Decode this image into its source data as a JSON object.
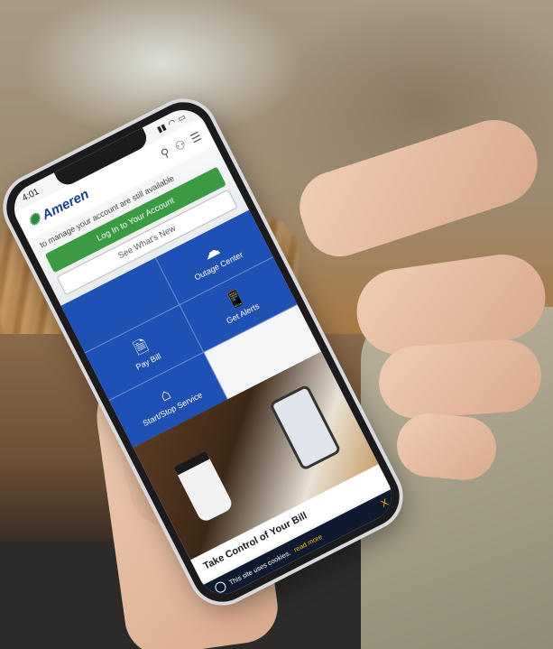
{
  "status": {
    "time": "4:01"
  },
  "app": {
    "brand": "Ameren"
  },
  "hero": {
    "text": "to manage your account are still available",
    "login_label": "Log In to Your Account",
    "whats_new_label": "See What's New"
  },
  "tiles": [
    {
      "label": "Outage Center",
      "icon": "cloud-icon"
    },
    {
      "label": "Pay Bill",
      "icon": "bill-icon"
    },
    {
      "label": "Get Alerts",
      "icon": "phone-alert-icon"
    },
    {
      "label": "Start/Stop Service",
      "icon": "house-icon"
    }
  ],
  "promo": {
    "title": "Take Control of Your Bill"
  },
  "cookie": {
    "text": "This site uses cookies.",
    "link": "read more",
    "close": "X"
  },
  "colors": {
    "brand_blue": "#1f50b4",
    "brand_green": "#3a9b42",
    "logo_blue": "#1a3f8c"
  }
}
